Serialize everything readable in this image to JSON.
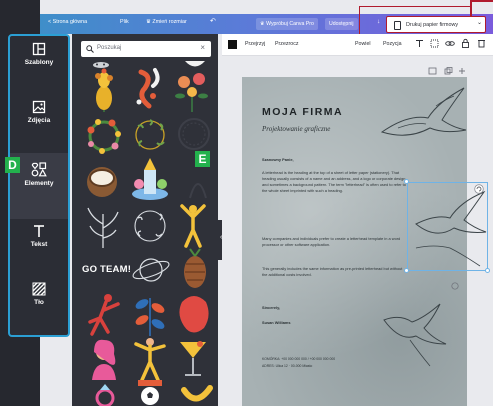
{
  "topbar": {
    "home": "< Strona główna",
    "file": "Plik",
    "resize": "♛ Zmień rozmiar",
    "undo": "↶",
    "try_pro": "♛ Wypróbuj Canva Pro",
    "share": "Udostępnij",
    "download": "↓",
    "print_label": "Drukuj papier firmowy",
    "print_chevron": "⌄"
  },
  "sidebar": {
    "items": [
      {
        "label": "Szablony",
        "icon": "templates-icon"
      },
      {
        "label": "Zdjęcia",
        "icon": "photos-icon"
      },
      {
        "label": "Elementy",
        "icon": "elements-icon"
      },
      {
        "label": "Tekst",
        "icon": "text-icon"
      },
      {
        "label": "Tło",
        "icon": "background-icon"
      }
    ],
    "active": "Elementy"
  },
  "callouts": {
    "d": "D",
    "e": "E"
  },
  "panel": {
    "search_placeholder": "Poszukaj",
    "clear": "×",
    "go_team": "GO TEAM!",
    "collapse": "‹"
  },
  "editor_toolbar": {
    "color_swatch": "#111111",
    "transparent": "Przejrzyj",
    "transparency": "Przezrocz",
    "back": "Powiel",
    "position": "Pozycja",
    "icons": [
      "filter-icon",
      "copy-icon",
      "link-icon",
      "lock-icon",
      "trash-icon"
    ]
  },
  "page_controls": {
    "icons": [
      "notes-icon",
      "duplicate-icon",
      "add-icon"
    ]
  },
  "document": {
    "company": "MOJA FIRMA",
    "subtitle": "Projektowanie graficzne",
    "greeting": "Szanowny Panie,",
    "paragraph1": "A letterhead is the heading at the top of a sheet of letter paper (stationery). That heading usually consists of a name and an address, and a logo or corporate design, and sometimes a background pattern. The term \"letterhead\" is often used to refer to the whole sheet imprinted with such a heading.",
    "paragraph2": "Many companies and individuals prefer to create a letterhead template in a word processor or other software application.",
    "paragraph3": "This generally includes the same information as pre-printed letterhead but without the additional costs involved.",
    "closing": "Sincerely,",
    "signature": "Susan Williams",
    "footer1": "KOMÓRKA: +00 000 000 000 / +00 000 000 000",
    "footer2": "ADRES: Ulica 12 · 00-000 Miasto"
  },
  "colors": {
    "accent_gradient_start": "#3f8ec9",
    "accent_gradient_end": "#7a5bdc",
    "rail_border": "#2b9fd4",
    "callout": "#23b14d",
    "highlight_red": "#b01b2e"
  }
}
